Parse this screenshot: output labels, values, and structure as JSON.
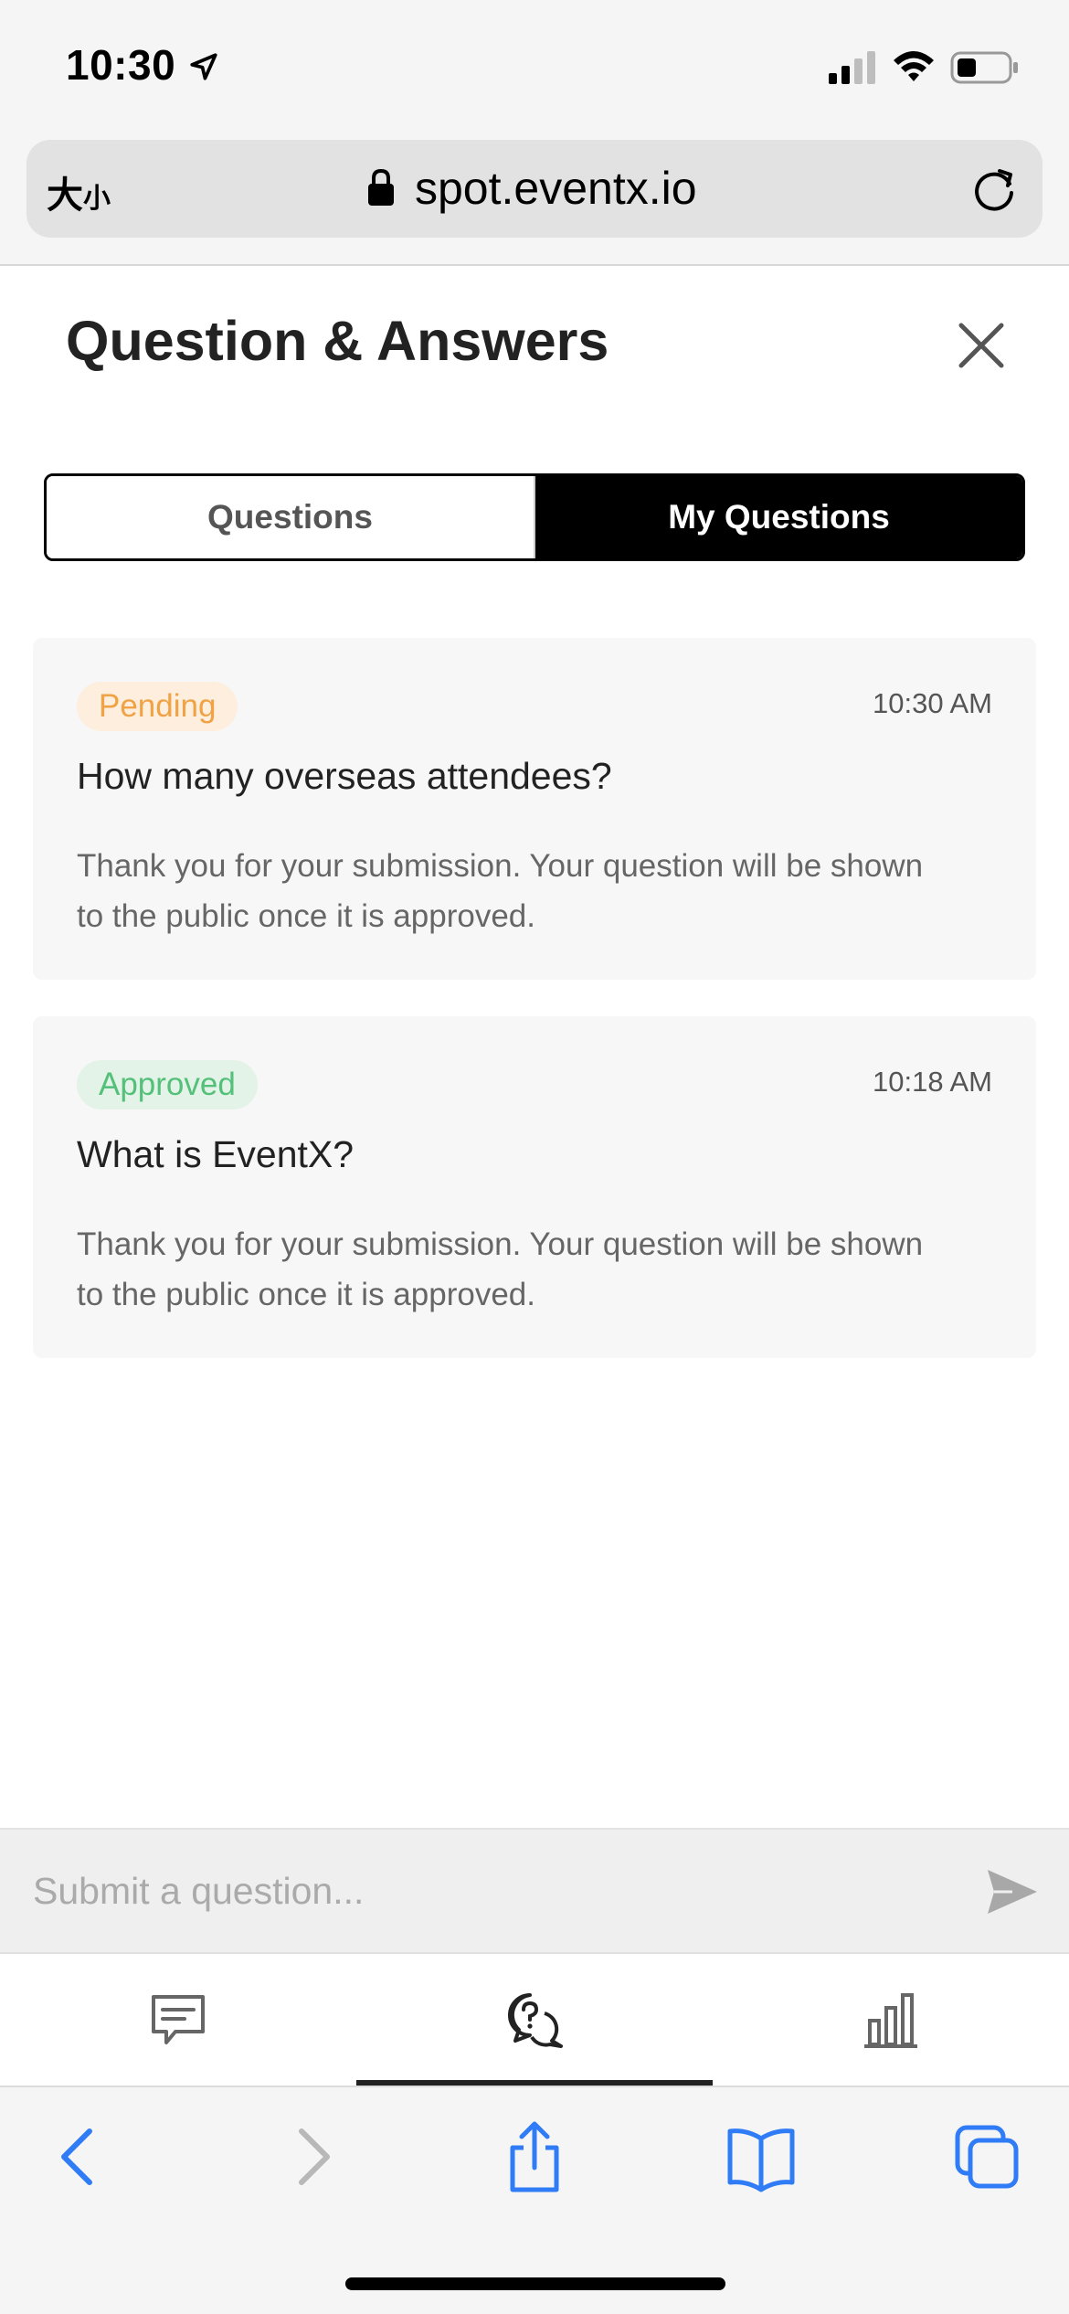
{
  "status_bar": {
    "time": "10:30"
  },
  "browser": {
    "text_size_label_big": "大",
    "text_size_label_small": "小",
    "url": "spot.eventx.io"
  },
  "header": {
    "title": "Question & Answers"
  },
  "tabs": [
    {
      "label": "Questions",
      "active": false
    },
    {
      "label": "My Questions",
      "active": true
    }
  ],
  "questions": [
    {
      "status": "Pending",
      "time": "10:30 AM",
      "question": "How many overseas attendees?",
      "note": "Thank you for your submission. Your question will be shown to the public once it is approved."
    },
    {
      "status": "Approved",
      "time": "10:18 AM",
      "question": "What is EventX?",
      "note": "Thank you for your submission. Your question will be shown to the public once it is approved."
    }
  ],
  "submit": {
    "placeholder": "Submit a question..."
  },
  "bottom_tabs": [
    {
      "icon": "chat-icon",
      "active": false
    },
    {
      "icon": "qa-icon",
      "active": true
    },
    {
      "icon": "poll-icon",
      "active": false
    }
  ],
  "colors": {
    "pending": "#f0a244",
    "approved": "#54c07a",
    "safari_blue": "#2f7cf6"
  }
}
